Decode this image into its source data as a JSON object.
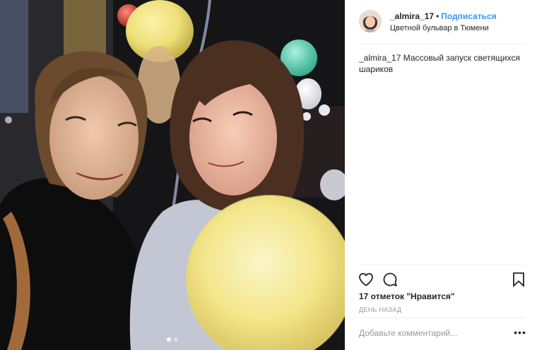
{
  "post": {
    "header": {
      "username": "_almira_17",
      "separator": "•",
      "follow_label": "Подписаться",
      "location": "Цветной бульвар в Тюмени"
    },
    "caption": {
      "username": "_almira_17",
      "text": "Массовый запуск светящихся шариков"
    },
    "actions": {
      "like_icon": "heart-icon",
      "comment_icon": "comment-bubble-icon",
      "save_icon": "bookmark-icon"
    },
    "likes_text": "17 отметок \"Нравится\"",
    "time_text": "ДЕНЬ НАЗАД",
    "comment": {
      "placeholder": "Добавьте комментарий...",
      "more_label": "•••"
    },
    "carousel": {
      "count": 2,
      "active_index": 0
    },
    "colors": {
      "link": "#3897f0",
      "text": "#262626",
      "muted": "#999999",
      "divider": "#efefef"
    }
  }
}
